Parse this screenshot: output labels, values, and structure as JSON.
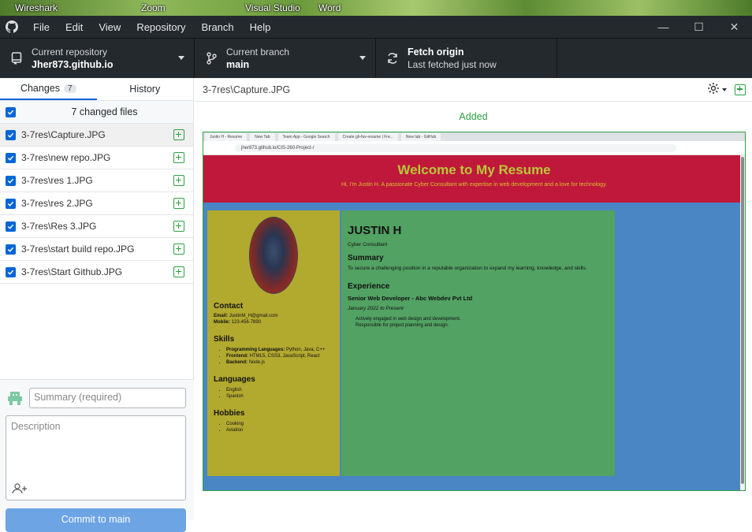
{
  "desktop": {
    "items": [
      "Wireshark",
      "Zoom",
      "Visual Studio",
      "Word"
    ]
  },
  "menu": {
    "items": [
      "File",
      "Edit",
      "View",
      "Repository",
      "Branch",
      "Help"
    ]
  },
  "toolbar": {
    "repo_label": "Current repository",
    "repo_value": "Jher873.github.io",
    "branch_label": "Current branch",
    "branch_value": "main",
    "fetch_label": "Fetch origin",
    "fetch_sub": "Last fetched just now"
  },
  "tabs": {
    "changes": "Changes",
    "changes_count": "7",
    "history": "History"
  },
  "changes": {
    "header": "7 changed files",
    "files": [
      "3-7res\\Capture.JPG",
      "3-7res\\new repo.JPG",
      "3-7res\\res 1.JPG",
      "3-7res\\res 2.JPG",
      "3-7res\\Res 3.JPG",
      "3-7res\\start build repo.JPG",
      "3-7res\\Start Github.JPG"
    ]
  },
  "commit": {
    "summary_placeholder": "Summary (required)",
    "description_placeholder": "Description",
    "button": "Commit to main"
  },
  "diff": {
    "path": "3-7res\\Capture.JPG",
    "status": "Added"
  },
  "preview": {
    "tab_labels": [
      "Justin H - Resume",
      "New Tab",
      "Team App - Google Search",
      "Create gh-fav-resume | Fre...",
      "New tab - GitHub"
    ],
    "url": "jher873.github.io/CIS-260-Project-/",
    "hero_title": "Welcome to My Resume",
    "hero_sub": "Hi, I'm Justin H. A passionate Cyber Consultant with expertise in web development and a love for technology.",
    "contact_h": "Contact",
    "email_label": "Email:",
    "email": "JustinM_H@gmail.com",
    "mobile_label": "Mobile:",
    "mobile": "123-456-7890",
    "skills_h": "Skills",
    "skills": [
      {
        "k": "Programming Languages:",
        "v": "Python, Java, C++"
      },
      {
        "k": "Frontend:",
        "v": "HTML5, CSS3, JavaScript, React"
      },
      {
        "k": "Backend:",
        "v": "Node.js"
      }
    ],
    "languages_h": "Languages",
    "languages": [
      "English",
      "Spanish"
    ],
    "hobbies_h": "Hobbies",
    "hobbies": [
      "Cooking",
      "Aviation"
    ],
    "name": "JUSTIN H",
    "role": "Cyber Consultant",
    "summary_h": "Summary",
    "summary": "To secure a challenging position in a reputable organization to expand my learning, knowledge, and skills.",
    "experience_h": "Experience",
    "job_title": "Senior Web Developer - Abc Webdev Pvt Ltd",
    "job_dates": "January 2022 to Present",
    "job_items": [
      "Actively engaged in web design and development.",
      "Responsible for project planning and design."
    ]
  }
}
